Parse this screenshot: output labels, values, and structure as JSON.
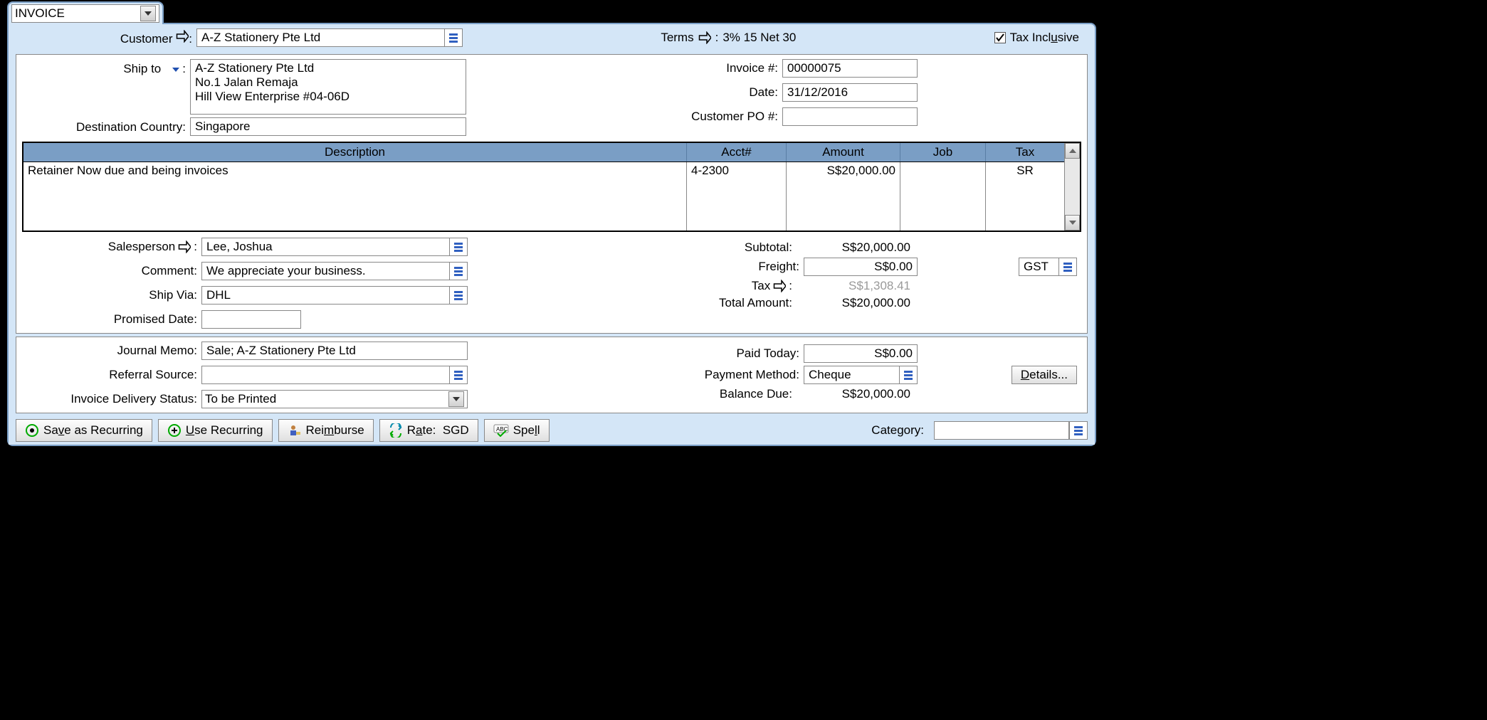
{
  "tab": {
    "type": "INVOICE"
  },
  "header": {
    "customer_label": "Customer",
    "customer": "A-Z Stationery Pte Ltd",
    "terms_label": "Terms",
    "terms": "3% 15 Net 30",
    "tax_inclusive_label": "Tax Inclusive",
    "tax_inclusive_checked": true
  },
  "ship": {
    "shipto_label": "Ship to",
    "name": "A-Z Stationery Pte Ltd",
    "addr1": "No.1 Jalan Remaja",
    "addr2": "Hill View Enterprise #04-06D",
    "dest_country_label": "Destination Country:",
    "dest_country": "Singapore"
  },
  "meta": {
    "invoice_no_label": "Invoice #:",
    "invoice_no": "00000075",
    "date_label": "Date:",
    "date": "31/12/2016",
    "customer_po_label": "Customer PO #:",
    "customer_po": ""
  },
  "grid": {
    "headers": {
      "description": "Description",
      "acct": "Acct#",
      "amount": "Amount",
      "job": "Job",
      "tax": "Tax"
    },
    "rows": [
      {
        "description": "Retainer Now due and being invoices",
        "acct": "4-2300",
        "amount": "S$20,000.00",
        "job": "",
        "tax": "SR"
      }
    ]
  },
  "lower": {
    "salesperson_label": "Salesperson",
    "salesperson": "Lee, Joshua",
    "comment_label": "Comment:",
    "comment": "We appreciate your business.",
    "shipvia_label": "Ship Via:",
    "shipvia": "DHL",
    "promised_label": "Promised Date:",
    "promised": ""
  },
  "totals": {
    "subtotal_label": "Subtotal:",
    "subtotal": "S$20,000.00",
    "freight_label": "Freight:",
    "freight": "S$0.00",
    "freight_tax_code": "GST",
    "tax_label": "Tax",
    "tax": "S$1,308.41",
    "total_label": "Total Amount:",
    "total": "S$20,000.00"
  },
  "footer": {
    "journal_memo_label": "Journal Memo:",
    "journal_memo": "Sale; A-Z Stationery Pte Ltd",
    "referral_label": "Referral Source:",
    "referral": "",
    "delivery_label": "Invoice Delivery Status:",
    "delivery": "To be Printed",
    "paid_today_label": "Paid Today:",
    "paid_today": "S$0.00",
    "payment_method_label": "Payment Method:",
    "payment_method": "Cheque",
    "details_btn": "Details...",
    "balance_label": "Balance Due:",
    "balance": "S$20,000.00"
  },
  "toolbar": {
    "save_recurring": "Save as Recurring",
    "use_recurring": "Use Recurring",
    "reimburse": "Reimburse",
    "rate_label": "Rate:",
    "rate_currency": "SGD",
    "spell": "Spell",
    "category_label": "Category:",
    "category": ""
  }
}
